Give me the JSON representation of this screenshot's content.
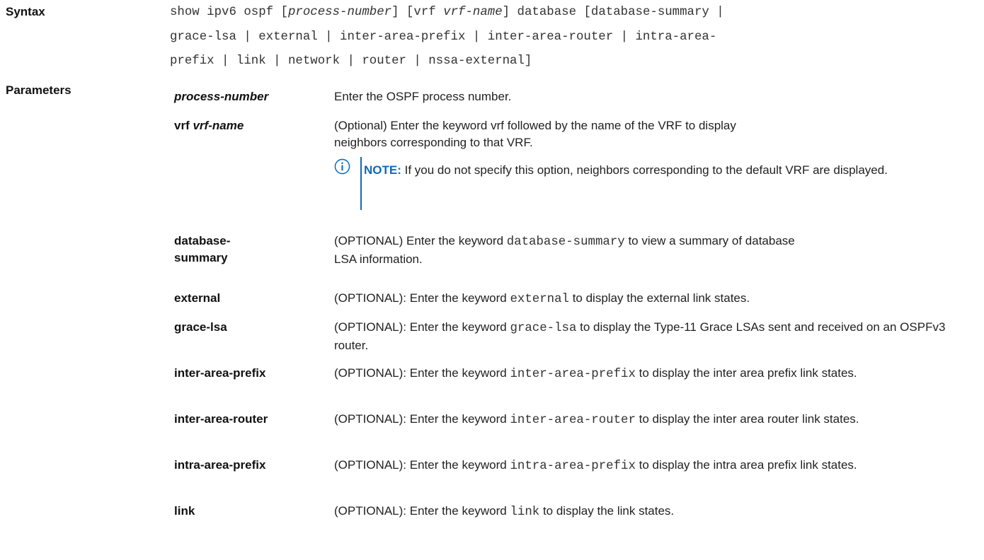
{
  "syntax": {
    "label": "Syntax",
    "line1": {
      "a": "show ipv6 ospf [",
      "b": "process-number",
      "c": "] [vrf ",
      "d": "vrf-name",
      "e": "] database [database-summary |"
    },
    "line2": "grace-lsa | external | inter-area-prefix | inter-area-router | intra-area-",
    "line3": "prefix | link | network | router | nssa-external]"
  },
  "parameters": {
    "label": "Parameters",
    "items": [
      {
        "term": "process-number",
        "desc": "Enter the OSPF process number."
      },
      {
        "term_a": "vrf ",
        "term_b": "vrf-name",
        "desc": "(Optional) Enter the keyword vrf followed by the name of the VRF to display neighbors corresponding to that VRF."
      },
      {
        "term": "database-summary",
        "desc_a": "(OPTIONAL) Enter the keyword ",
        "kw": "database-summary",
        "desc_b": " to view a summary of database LSA information."
      },
      {
        "term": "external",
        "desc_a": "(OPTIONAL): Enter the keyword ",
        "kw": "external",
        "desc_b": " to display the external link states."
      },
      {
        "term": "grace-lsa",
        "desc_a": "(OPTIONAL): Enter the keyword ",
        "kw": "grace-lsa",
        "desc_b": " to display the Type-11 Grace LSAs sent and received on an OSPFv3 router."
      },
      {
        "term": "inter-area-prefix",
        "desc_a": "(OPTIONAL): Enter the keyword ",
        "kw": "inter-area-prefix",
        "desc_b": " to display the inter area prefix link states."
      },
      {
        "term": "inter-area-router",
        "desc_a": "(OPTIONAL): Enter the keyword ",
        "kw": "inter-area-router",
        "desc_b": " to display the inter area router link states."
      },
      {
        "term": "intra-area-prefix",
        "desc_a": "(OPTIONAL): Enter the keyword ",
        "kw": "intra-area-prefix",
        "desc_b": " to display the intra area prefix link states."
      },
      {
        "term": "link",
        "desc_a": "(OPTIONAL): Enter the keyword ",
        "kw": "link",
        "desc_b": " to display the link states."
      }
    ]
  },
  "note": {
    "icon": "info-icon",
    "label": "NOTE:",
    "text": " If you do not specify this option, neighbors corresponding to the default VRF are displayed."
  },
  "colors": {
    "note_accent": "#0d6bb8"
  }
}
